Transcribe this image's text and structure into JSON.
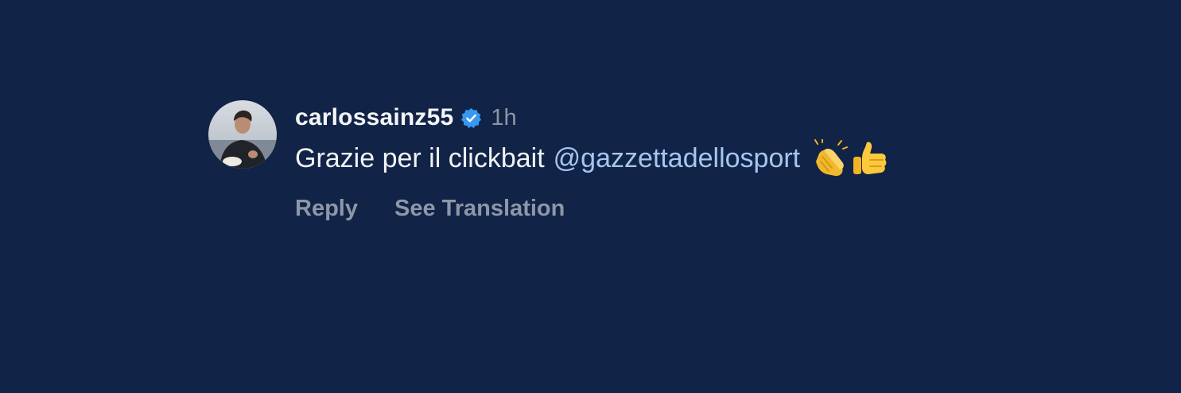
{
  "comment": {
    "username": "carlossainz55",
    "verified": true,
    "timestamp": "1h",
    "text": "Grazie per il clickbait",
    "mention": "@gazzettadellosport",
    "emojis": [
      "clapping-hands-emoji",
      "thumbs-up-emoji"
    ],
    "actions": {
      "reply_label": "Reply",
      "translate_label": "See Translation"
    }
  },
  "colors": {
    "background": "#112447",
    "username": "#f5f5f7",
    "text": "#f2f2f4",
    "mention": "#a7c5ee",
    "muted": "#8e96a8",
    "verified_badge": "#3897f0"
  }
}
